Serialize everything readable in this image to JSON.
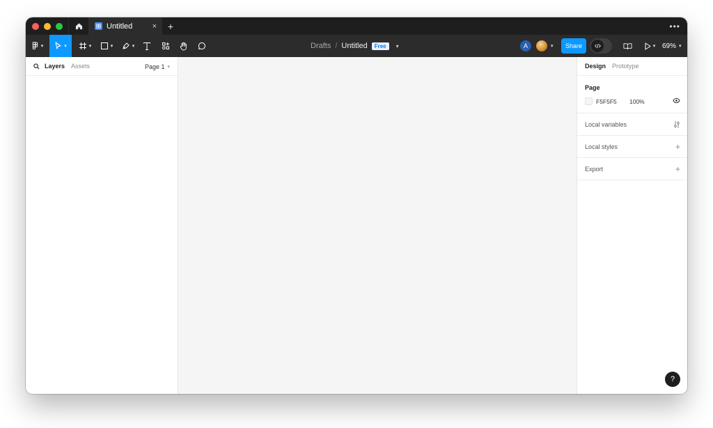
{
  "window": {
    "traffic_lights": {
      "close": "#ff5f57",
      "minimize": "#febc2e",
      "zoom": "#28c840"
    },
    "home_icon": "home-icon",
    "tab": {
      "label": "Untitled",
      "close_glyph": "×"
    },
    "new_tab_glyph": "+",
    "more_glyph": "•••"
  },
  "toolbar": {
    "tools": [
      "main-menu",
      "move",
      "frame",
      "shape",
      "pen",
      "text",
      "resources",
      "hand",
      "comment"
    ],
    "active_tool": "move",
    "breadcrumb": {
      "folder": "Drafts",
      "separator": "/",
      "file": "Untitled",
      "plan_badge": "Free"
    },
    "avatar_initial": "A",
    "share_label": "Share",
    "dev_mode_icon": "code-icon",
    "zoom": "69%",
    "accent_color": "#0d99ff"
  },
  "left_panel": {
    "tabs": [
      "Layers",
      "Assets"
    ],
    "active_tab": "Layers",
    "page_select": "Page 1"
  },
  "right_panel": {
    "tabs": [
      "Design",
      "Prototype"
    ],
    "active_tab": "Design",
    "page": {
      "title": "Page",
      "color_hex": "F5F5F5",
      "opacity": "100%"
    },
    "sections": [
      {
        "title": "Local variables",
        "icon": "sliders-icon"
      },
      {
        "title": "Local styles",
        "icon": "plus-icon"
      },
      {
        "title": "Export",
        "icon": "plus-icon"
      }
    ]
  },
  "canvas": {
    "background": "#f5f5f5"
  },
  "help_glyph": "?"
}
